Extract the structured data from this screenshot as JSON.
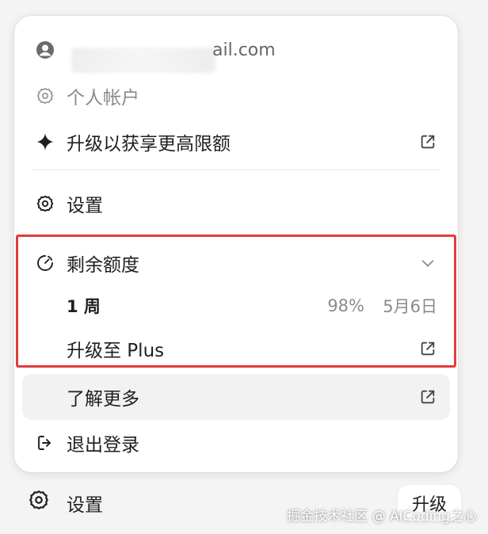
{
  "account": {
    "email_visible": "ail.com",
    "personal_account": "个人帐户"
  },
  "menu": {
    "upgrade_limits": "升级以获享更高限额",
    "settings": "设置",
    "remaining_quota": "剩余额度",
    "usage_period": "1 周",
    "usage_percent": "98%",
    "usage_reset": "5月6日",
    "upgrade_plus": "升级至 Plus",
    "learn_more": "了解更多",
    "logout": "退出登录"
  },
  "bottom_bar": {
    "settings": "设置",
    "upgrade": "升级"
  },
  "watermark": "掘金技术社区 @ AICoding之心",
  "colors": {
    "highlight_border": "#e33b3b",
    "hover_bg": "#f2f2f2"
  }
}
